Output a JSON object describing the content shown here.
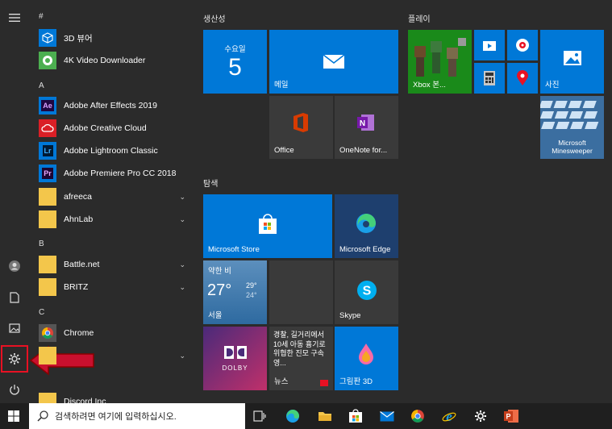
{
  "applist": {
    "sec_hash": "#",
    "sec_a": "A",
    "sec_b": "B",
    "sec_c": "C",
    "app_3d": "3D 뷰어",
    "app_4k": "4K Video Downloader",
    "app_ae": "Adobe After Effects 2019",
    "app_acc": "Adobe Creative Cloud",
    "app_lr": "Adobe Lightroom Classic",
    "app_pr": "Adobe Premiere Pro CC 2018",
    "app_afreeca": "afreeca",
    "app_ahnlab": "AhnLab",
    "app_battle": "Battle.net",
    "app_britz": "BRITZ",
    "app_chrome": "Chrome",
    "app_discord": "Discord Inc"
  },
  "groups": {
    "productivity": "생산성",
    "play": "플레이",
    "explore": "탐색"
  },
  "tiles": {
    "calendar_day": "수요일",
    "calendar_date": "5",
    "mail": "메일",
    "xbox": "Xbox 본...",
    "photos": "사진",
    "office": "Office",
    "onenote": "OneNote for...",
    "minesweeper": "Microsoft Minesweeper",
    "store": "Microsoft Store",
    "edge": "Microsoft Edge",
    "weather_cond": "약한 비",
    "weather_temp": "27°",
    "weather_hi": "29°",
    "weather_lo": "24°",
    "weather_city": "서울",
    "skype": "Skype",
    "news_headline": "경찰, 길거리에서 10세 아동 흉기로 위협한 진모 구속영...",
    "news": "뉴스",
    "paint3d": "그림판 3D",
    "dolby": "DOLBY"
  },
  "taskbar": {
    "search_placeholder": "검색하려면 여기에 입력하십시오."
  },
  "colors": {
    "tile_blue": "#0078d7",
    "tile_dark": "#3a3a3a",
    "highlight_red": "#e81123",
    "arrow_red": "#c8102e"
  }
}
